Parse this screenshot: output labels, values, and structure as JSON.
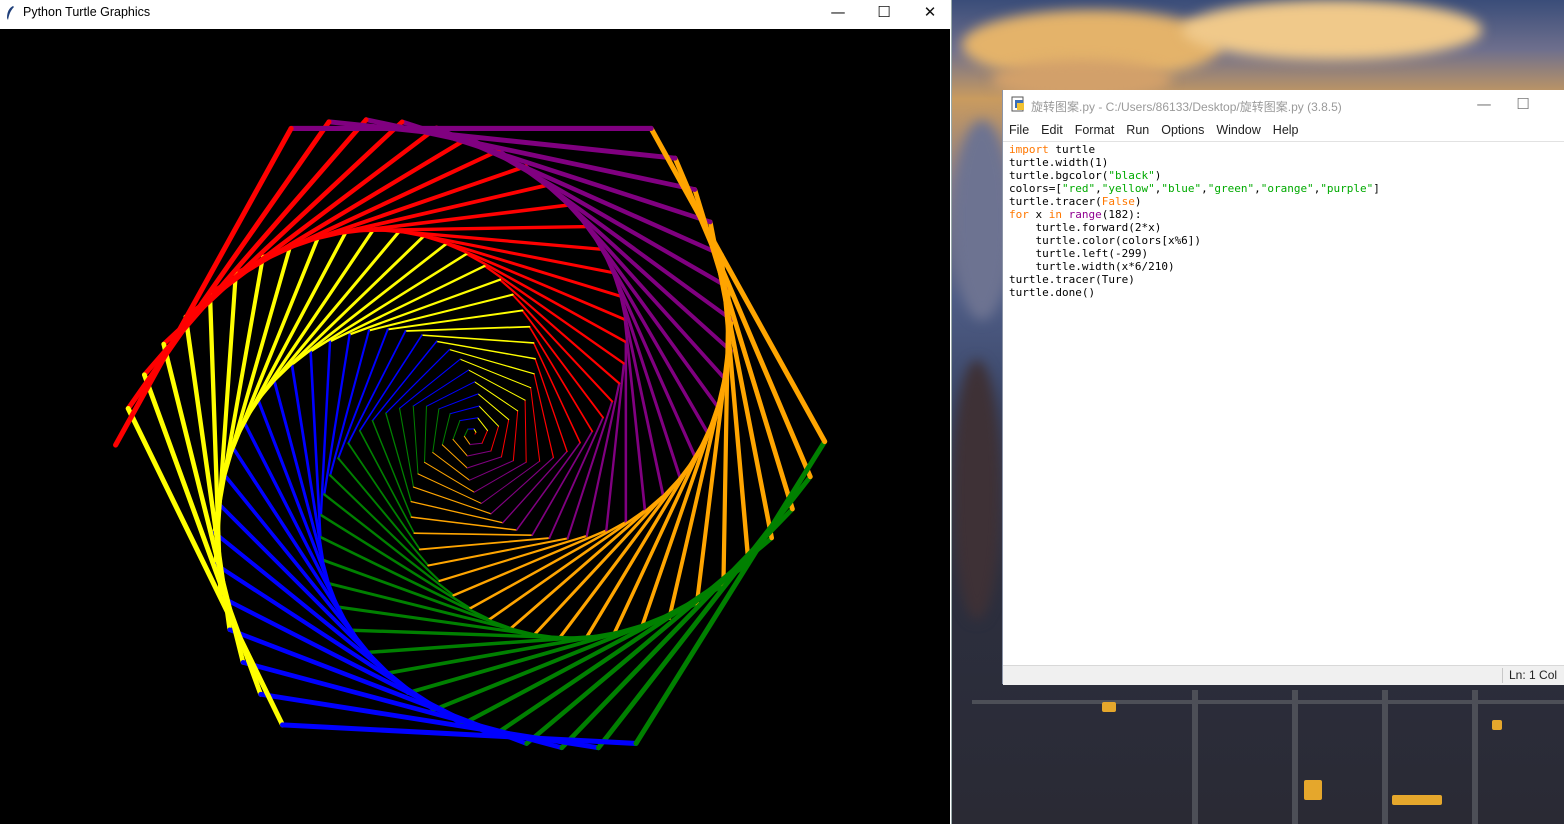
{
  "turtle_window": {
    "title": "Python Turtle Graphics",
    "minimize_glyph": "—",
    "maximize_glyph": "☐",
    "close_glyph": "✕",
    "background": "#000000"
  },
  "idle_window": {
    "title": "旋转图案.py - C:/Users/86133/Desktop/旋转图案.py (3.8.5)",
    "minimize_glyph": "—",
    "maximize_glyph": "☐",
    "menu": [
      "File",
      "Edit",
      "Format",
      "Run",
      "Options",
      "Window",
      "Help"
    ],
    "status": "Ln: 1   Col"
  },
  "colors": {
    "keyword": "#ff7700",
    "builtin": "#900090",
    "string": "#00aa00",
    "spiral": [
      "#ff0000",
      "#ffff00",
      "#0000ff",
      "#008000",
      "#ffa500",
      "#800080"
    ]
  },
  "icons": [
    "python-feather-icon",
    "idle-file-icon"
  ]
}
